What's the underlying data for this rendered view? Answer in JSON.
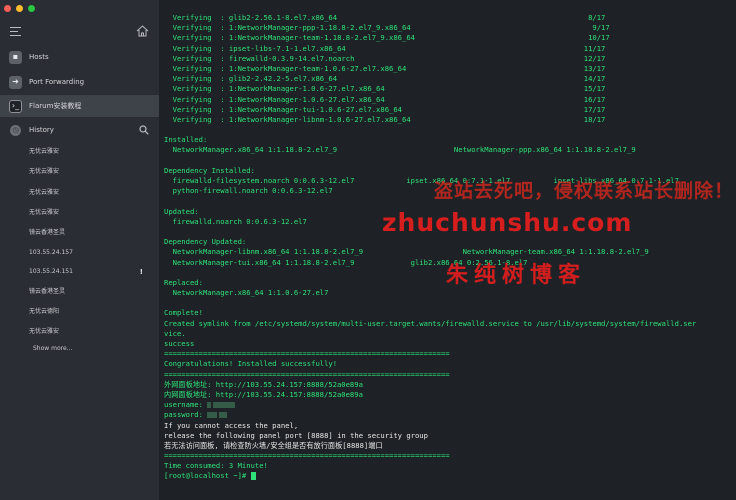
{
  "sidebar": {
    "nav": [
      {
        "label": "Hosts",
        "icon": "hosts-icon"
      },
      {
        "label": "Port Forwarding",
        "icon": "arrow-right-icon"
      },
      {
        "label": "Flarum安装教程",
        "icon": "terminal-icon"
      }
    ],
    "history_label": "History",
    "history": [
      "无忧云雅安",
      "无忧云雅安",
      "无忧云雅安",
      "无忧云雅安",
      "镜云香港圣灵",
      "103.55.24.157",
      "103.55.24.151",
      "镜云香港圣灵",
      "无忧云德阳",
      "无忧云雅安"
    ],
    "history_warn": "!",
    "show_more": "Show more..."
  },
  "terminal": {
    "lines": [
      [
        {
          "t": "  Verifying  : glib2-2.56.1-8.el7.x86_64                                                          8/17"
        }
      ],
      [
        {
          "t": "  Verifying  : 1:NetworkManager-ppp-1.18.8-2.el7_9.x86_64                                          9/17"
        }
      ],
      [
        {
          "t": "  Verifying  : 1:NetworkManager-team-1.18.8-2.el7_9.x86_64                                        10/17"
        }
      ],
      [
        {
          "t": "  Verifying  : ipset-libs-7.1-1.el7.x86_64                                                       11/17"
        }
      ],
      [
        {
          "t": "  Verifying  : firewalld-0.3.9-14.el7.noarch                                                     12/17"
        }
      ],
      [
        {
          "t": "  Verifying  : 1:NetworkManager-team-1.0.6-27.el7.x86_64                                         13/17"
        }
      ],
      [
        {
          "t": "  Verifying  : glib2-2.42.2-5.el7.x86_64                                                         14/17"
        }
      ],
      [
        {
          "t": "  Verifying  : 1:NetworkManager-1.0.6-27.el7.x86_64                                              15/17"
        }
      ],
      [
        {
          "t": "  Verifying  : 1:NetworkManager-1.0.6-27.el7.x86_64                                              16/17"
        }
      ],
      [
        {
          "t": "  Verifying  : 1:NetworkManager-tui-1.0.6-27.el7.x86_64                                          17/17"
        }
      ],
      [
        {
          "t": "  Verifying  : 1:NetworkManager-libnm-1.0.6-27.el7.x86_64                                        18/17"
        }
      ],
      [
        {
          "t": ""
        }
      ],
      [
        {
          "t": "Installed:"
        }
      ],
      [
        {
          "t": "  NetworkManager.x86_64 1:1.18.8-2.el7_9                           NetworkManager-ppp.x86_64 1:1.18.8-2.el7_9"
        }
      ],
      [
        {
          "t": ""
        }
      ],
      [
        {
          "t": "Dependency Installed:"
        }
      ],
      [
        {
          "t": "  firewalld-filesystem.noarch 0:0.6.3-12.el7            ipset.x86_64 0:7.1-1.el7          ipset-libs.x86_64 0:7.1-1.el7"
        }
      ],
      [
        {
          "t": "  python-firewall.noarch 0:0.6.3-12.el7"
        }
      ],
      [
        {
          "t": ""
        }
      ],
      [
        {
          "t": "Updated:"
        }
      ],
      [
        {
          "t": "  firewalld.noarch 0:0.6.3-12.el7"
        }
      ],
      [
        {
          "t": ""
        }
      ],
      [
        {
          "t": "Dependency Updated:"
        }
      ],
      [
        {
          "t": "  NetworkManager-libnm.x86_64 1:1.18.8-2.el7_9                       NetworkManager-team.x86_64 1:1.18.8-2.el7_9"
        }
      ],
      [
        {
          "t": "  NetworkManager-tui.x86_64 1:1.18.8-2.el7_9             glib2.x86_64 0:2.56.1-8.el7"
        }
      ],
      [
        {
          "t": ""
        }
      ],
      [
        {
          "t": "Replaced:"
        }
      ],
      [
        {
          "t": "  NetworkManager.x86_64 1:1.0.6-27.el7"
        }
      ],
      [
        {
          "t": ""
        }
      ],
      [
        {
          "t": "Complete!"
        }
      ],
      [
        {
          "t": "Created symlink from /etc/systemd/system/multi-user.target.wants/firewalld.service to /usr/lib/systemd/system/firewalld.ser"
        }
      ],
      [
        {
          "t": "vice."
        }
      ],
      [
        {
          "t": "success"
        }
      ],
      [
        {
          "t": "=================================================================="
        }
      ],
      [
        {
          "t": "Congratulations! Installed successfully!"
        }
      ],
      [
        {
          "t": "=================================================================="
        }
      ],
      [
        {
          "t": "外网面板地址: http://103.55.24.157:8888/52a0e89a"
        }
      ],
      [
        {
          "t": "内网面板地址: http://103.55.24.157:8888/52a0e89a"
        }
      ],
      [
        {
          "t": "username: ",
          "mask": [
            4,
            22
          ]
        }
      ],
      [
        {
          "t": "password: ",
          "mask": [
            10,
            8
          ]
        }
      ],
      [
        {
          "t": "If you cannot access the panel,",
          "w": true
        }
      ],
      [
        {
          "t": "release the following panel port [8888] in the security group",
          "w": true
        }
      ],
      [
        {
          "t": "若无法访问面板, 请检查防火墙/安全组是否有放行面板[8888]端口",
          "w": true
        }
      ],
      [
        {
          "t": "=================================================================="
        }
      ],
      [
        {
          "t": "Time consumed: 3 Minute!"
        }
      ],
      [
        {
          "t": "[root@localhost ~]# ",
          "cursor": true
        }
      ]
    ],
    "watermark": {
      "line1": "盗站去死吧，侵权联系站长删除！",
      "line2": "zhuchunshu.com",
      "line3": "朱纯树博客"
    }
  }
}
